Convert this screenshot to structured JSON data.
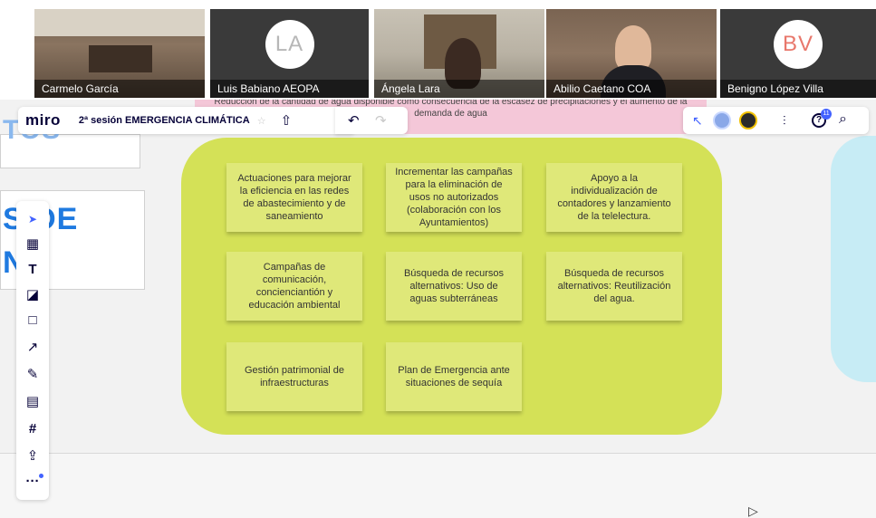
{
  "participants": [
    {
      "name": "Carmelo García",
      "type": "video"
    },
    {
      "name": "Luis Babiano AEOPA",
      "type": "avatar",
      "initials": "LA",
      "color": "#b7b7b7"
    },
    {
      "name": "Ángela Lara",
      "type": "video"
    },
    {
      "name": "Abilio Caetano COA",
      "type": "video"
    },
    {
      "name": "Benigno López Villa",
      "type": "avatar",
      "initials": "BV",
      "color": "#e8776b"
    }
  ],
  "header": {
    "logo": "miro",
    "board_title": "2ª sesión EMERGENCIA CLIMÁTICA",
    "star": "☆",
    "share": "⇧",
    "undo": "↶",
    "redo": "↷"
  },
  "pink_note": {
    "text": "Reducción de la cantidad de agua disponible como consecuencia de la escasez de precipitaciones y el aumento de la demanda de agua"
  },
  "right_bar": {
    "cursor_arrow": "↖",
    "settings": "⫶",
    "help": "?",
    "search": "⌕",
    "notifications": "11"
  },
  "board_left": {
    "partial_top": "TOS",
    "partial_mid_1": "S DE",
    "partial_mid_2": "N"
  },
  "toolbar": {
    "select": "➤",
    "table": "▦",
    "text": "T",
    "sticky": "◪",
    "shape": "□",
    "connector": "↗",
    "pen": "✎",
    "comment": "▤",
    "frame": "#",
    "upload": "⇪",
    "more": "···"
  },
  "colors": {
    "group_frame": "#d4e157",
    "sticky": "#dfe879",
    "blue_text": "#1f7ae0",
    "accent": "#4262ff"
  },
  "stickies": [
    "Actuaciones para mejorar la eficiencia en las redes de abastecimiento y de saneamiento",
    "Incrementar las campañas para la eliminación de usos no autorizados (colaboración con los Ayuntamientos)",
    "Apoyo a la individualización de contadores y lanzamiento de la telelectura.",
    "Campañas de comunicación, concienciantión y educación ambiental",
    "Búsqueda de recursos alternativos: Uso de aguas subterráneas",
    "Búsqueda de recursos alternativos: Reutilización del agua.",
    "Gestión patrimonial de infraestructuras",
    "Plan de Emergencia ante situaciones de sequía"
  ]
}
